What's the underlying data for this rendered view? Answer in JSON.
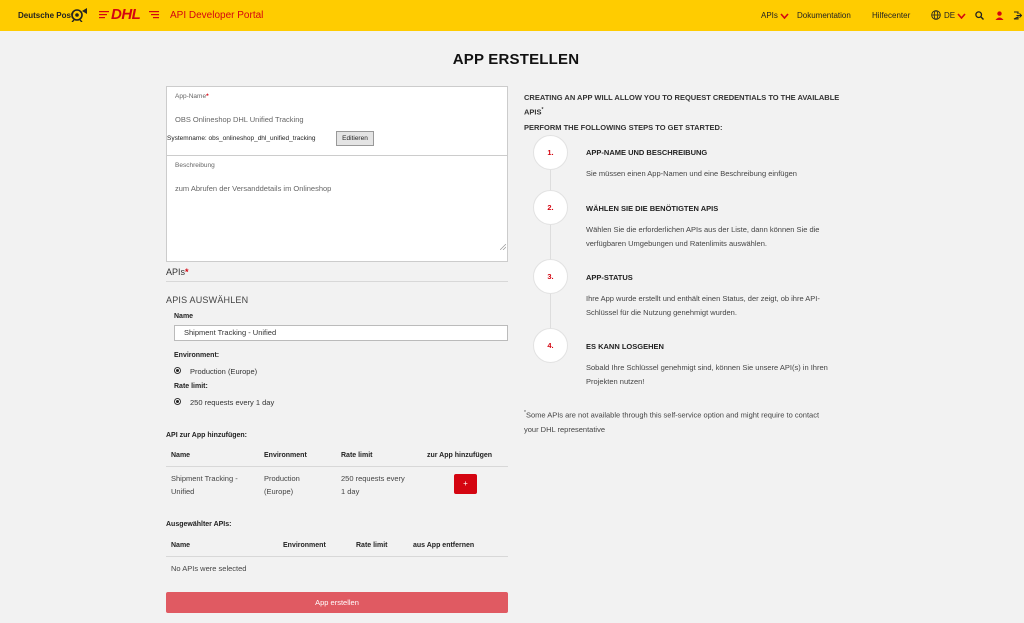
{
  "header": {
    "brand_dp": "Deutsche Post",
    "brand_dhl": "DHL",
    "portal_title": "API Developer Portal",
    "nav": {
      "apis": "APIs",
      "docs": "Dokumentation",
      "help": "Hilfecenter",
      "lang": "DE"
    }
  },
  "page": {
    "title": "APP ERSTELLEN"
  },
  "form": {
    "app_name": {
      "label": "App-Name",
      "value": "OBS Onlineshop DHL Unified Tracking"
    },
    "systemname": "Systemname: obs_onlineshop_dhl_unified_tracking",
    "edit_label": "Editieren",
    "description": {
      "label": "Beschreibung",
      "value": "zum Abrufen der Versanddetails im Onlineshop"
    },
    "apis_label": "APIs",
    "select_heading": "APIS AUSWÄHLEN",
    "name_label": "Name",
    "name_value": "Shipment Tracking - Unified",
    "environment_label": "Environment:",
    "environment_value": "Production (Europe)",
    "rate_label": "Rate limit:",
    "rate_value": "250 requests every 1 day",
    "add_heading": "API zur App hinzufügen:",
    "add_table": {
      "headers": [
        "Name",
        "Environment",
        "Rate limit",
        "zur App hinzufügen"
      ],
      "row": {
        "name_l1": "Shipment Tracking -",
        "name_l2": "Unified",
        "env_l1": "Production",
        "env_l2": "(Europe)",
        "rate_l1": "250 requests every",
        "rate_l2": "1 day",
        "add": "+"
      }
    },
    "selected_heading": "Ausgewählter APIs:",
    "selected_table": {
      "headers": [
        "Name",
        "Environment",
        "Rate limit",
        "aus App entfernen"
      ],
      "empty": "No APIs were selected"
    },
    "create_button": "App erstellen"
  },
  "info": {
    "intro_l1": "CREATING AN APP WILL ALLOW YOU TO REQUEST CREDENTIALS TO THE AVAILABLE",
    "intro_l2": "APIS",
    "intro_mark": "*",
    "steps_heading": "PERFORM THE FOLLOWING STEPS TO GET STARTED:",
    "steps": [
      {
        "num": "1.",
        "title": "APP-NAME UND BESCHREIBUNG",
        "l1": "Sie müssen einen App-Namen und eine Beschreibung einfügen",
        "l2": ""
      },
      {
        "num": "2.",
        "title": "WÄHLEN SIE DIE BENÖTIGTEN APIS",
        "l1": "Wählen Sie die erforderlichen APIs aus der Liste, dann können Sie die",
        "l2": "verfügbaren Umgebungen und Ratenlimits auswählen."
      },
      {
        "num": "3.",
        "title": "APP-STATUS",
        "l1": "Ihre App wurde erstellt und enthält einen Status, der zeigt, ob ihre API-",
        "l2": "Schlüssel für die Nutzung genehmigt wurden."
      },
      {
        "num": "4.",
        "title": "ES KANN LOSGEHEN",
        "l1": "Sobald Ihre Schlüssel genehmigt sind, können Sie unsere API(s) in Ihren",
        "l2": "Projekten nutzen!"
      }
    ],
    "footnote_mark": "*",
    "footnote_l1": "Some APIs are not available through this self-service option and might require to contact",
    "footnote_l2": "your DHL representative"
  },
  "colors": {
    "brand_yellow": "#ffcc00",
    "brand_red": "#d40511",
    "create_button": "#e05a62"
  }
}
